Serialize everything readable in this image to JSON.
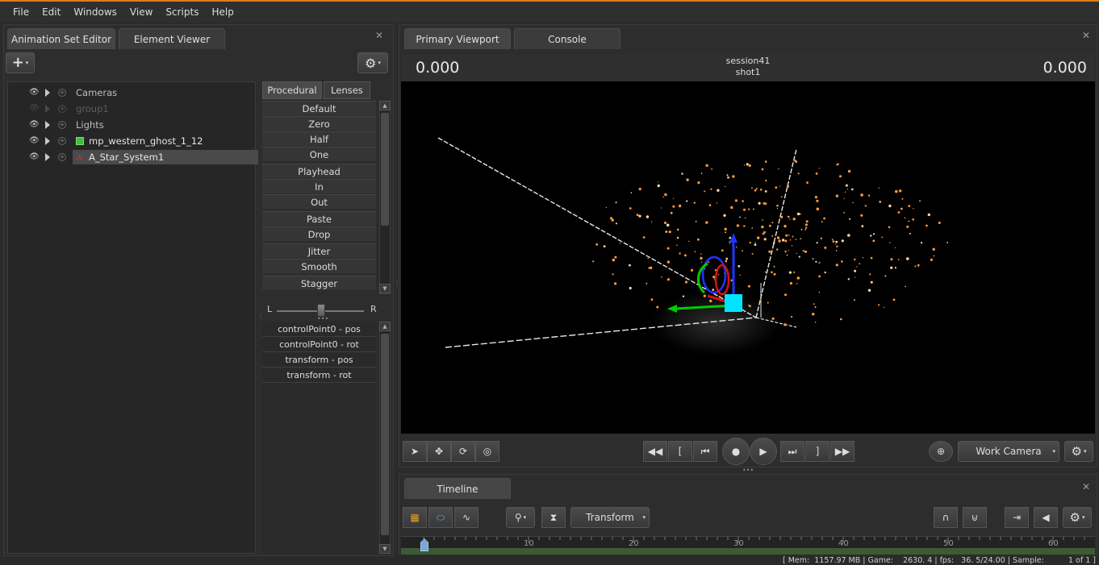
{
  "menu": [
    "File",
    "Edit",
    "Windows",
    "View",
    "Scripts",
    "Help"
  ],
  "left_panel": {
    "tabs": [
      "Animation Set Editor",
      "Element Viewer"
    ],
    "tree": [
      {
        "label": "Cameras",
        "icon": "none",
        "dim": false
      },
      {
        "label": "group1",
        "icon": "none",
        "dim": true
      },
      {
        "label": "Lights",
        "icon": "none",
        "dim": false
      },
      {
        "label": "mp_western_ghost_1_12",
        "icon": "cube-icon",
        "dim": false
      },
      {
        "label": "A_Star_System1",
        "icon": "particle-icon",
        "dim": false,
        "selected": true
      }
    ],
    "proc_tabs": [
      "Procedural",
      "Lenses"
    ],
    "proc_buttons": [
      "Default",
      "Zero",
      "Half",
      "One",
      "Playhead",
      "In",
      "Out",
      "Paste",
      "Drop",
      "Jitter",
      "Smooth",
      "Stagger"
    ],
    "slider": {
      "left": "L",
      "right": "R",
      "value": 0.5
    },
    "controls": [
      "controlPoint0 - pos",
      "controlPoint0 - rot",
      "transform - pos",
      "transform - rot"
    ]
  },
  "viewport_panel": {
    "tabs": [
      "Primary Viewport",
      "Console"
    ],
    "time_left": "0.000",
    "time_right": "0.000",
    "session": "session41",
    "shot": "shot1",
    "camera": "Work Camera"
  },
  "timeline": {
    "tab": "Timeline",
    "mode": "Transform",
    "ticks": [
      "10",
      "20",
      "30",
      "40",
      "50",
      "60"
    ]
  },
  "status": {
    "text": "[ Mem:  1157.97 MB | Game:    2630. 4 | fps:   36. 5/24.00 | Sample:          1 of 1 ]"
  },
  "colors": {
    "accent": "#e07a1f",
    "gizmo_x": "#00cc00",
    "gizmo_y": "#2233ff",
    "gizmo_z": "#dd1111",
    "handle": "#00e5ff",
    "particle": "#ff9a3c"
  }
}
